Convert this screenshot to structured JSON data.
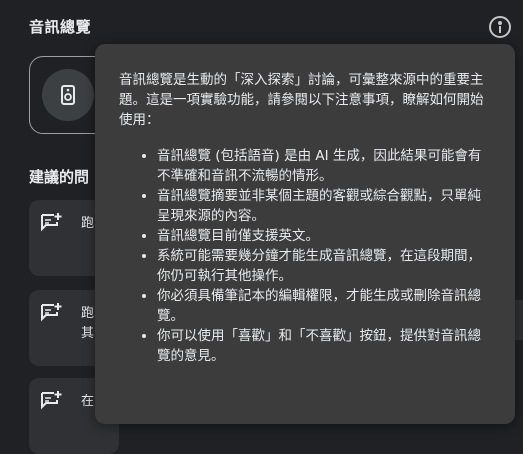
{
  "header": {
    "title": "音訊總覽",
    "info_icon": "info-icon"
  },
  "audio_overview": {
    "icon": "speaker-icon"
  },
  "suggestions": {
    "title": "建議的問",
    "items": [
      {
        "text": "跑",
        "icon": "question-add-icon"
      },
      {
        "text": "跑\n其",
        "icon": "question-add-icon"
      },
      {
        "text": "在",
        "icon": "question-add-icon"
      }
    ]
  },
  "popover": {
    "intro": "音訊總覽是生動的「深入探索」討論，可彙整來源中的重要主題。這是一項實驗功能，請參閱以下注意事項，瞭解如何開始使用：",
    "notes": [
      "音訊總覽 (包括語音) 是由 AI 生成，因此結果可能會有不準確和音訊不流暢的情形。",
      "音訊總覽摘要並非某個主題的客觀或綜合觀點，只單純呈現來源的內容。",
      "音訊總覽目前僅支援英文。",
      "系統可能需要幾分鐘才能生成音訊總覽，在這段期間，你仍可執行其他操作。",
      "你必須具備筆記本的編輯權限，才能生成或刪除音訊總覽。",
      "你可以使用「喜歡」和「不喜歡」按鈕，提供對音訊總覽的意見。"
    ]
  }
}
